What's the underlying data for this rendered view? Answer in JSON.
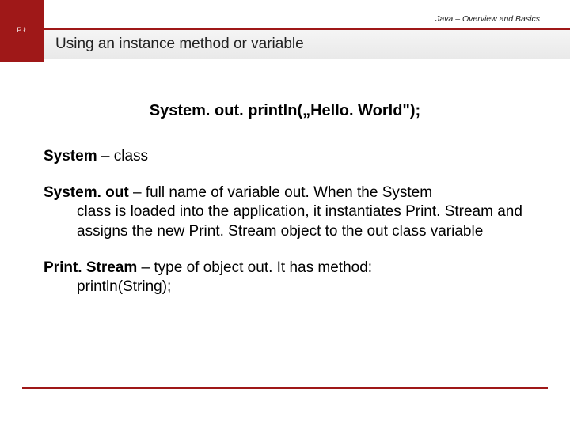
{
  "header": {
    "course_label": "Java – Overview and Basics",
    "logo_text": "P Ł",
    "slide_title": "Using an instance method or variable"
  },
  "content": {
    "code_headline": "System. out. println(„Hello. World\");",
    "para1_term": "System",
    "para1_rest": " – class",
    "para2_term": "System. out",
    "para2_rest_firstline": " – full name of variable out. When the System",
    "para2_rest_block": "class is loaded into the application, it instantiates Print. Stream and assigns the new Print. Stream object to the out class variable",
    "para3_term": "Print. Stream",
    "para3_rest_firstline": " – type of object out. It has method:",
    "para3_rest_block": "println(String);"
  }
}
